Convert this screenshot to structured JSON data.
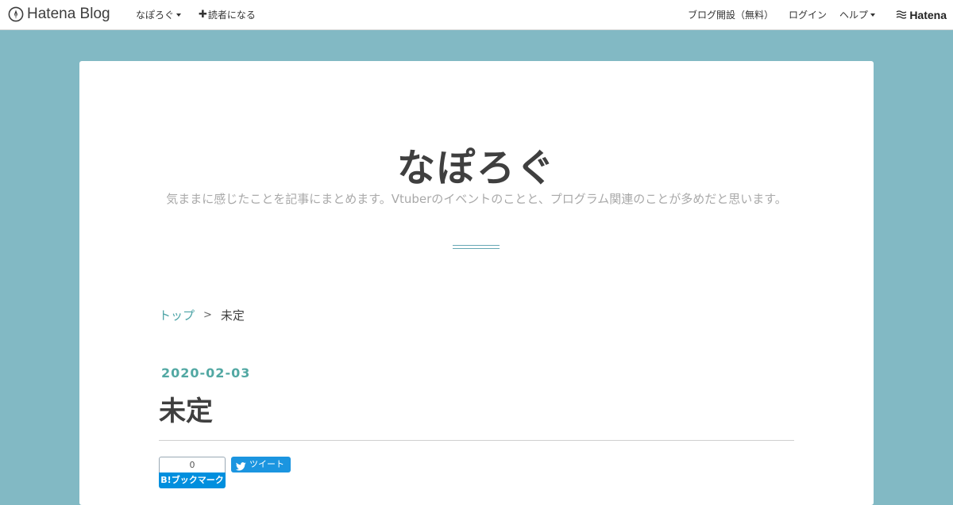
{
  "topbar": {
    "brand_text": "Hatena Blog",
    "blog_menu_label": "なぽろぐ",
    "subscribe_label": "読者になる",
    "start_blog_label": "ブログ開設（無料）",
    "login_label": "ログイン",
    "help_label": "ヘルプ",
    "hatena_label": "Hatena"
  },
  "blog": {
    "title": "なぽろぐ",
    "description": "気ままに感じたことを記事にまとめます。Vtuberのイベントのことと、プログラム関連のことが多めだと思います。"
  },
  "breadcrumb": {
    "top_label": "トップ",
    "separator": ">",
    "current_label": "未定"
  },
  "entry": {
    "date": "2020-02-03",
    "title": "未定"
  },
  "share": {
    "hatena_bookmark_count": "0",
    "hatena_bookmark_label": "B!ブックマーク",
    "tweet_label": "ツイート"
  },
  "colors": {
    "page_background": "#82b9c4",
    "accent": "#52a8a3",
    "hatena_blue": "#008fde",
    "twitter_blue": "#1b95e0"
  },
  "icons": {
    "brand_logo": "hatena-blog-pen-icon",
    "subscribe": "plus-icon",
    "hatena_logo": "hatena-wave-icon",
    "tweet": "twitter-bird-icon"
  }
}
